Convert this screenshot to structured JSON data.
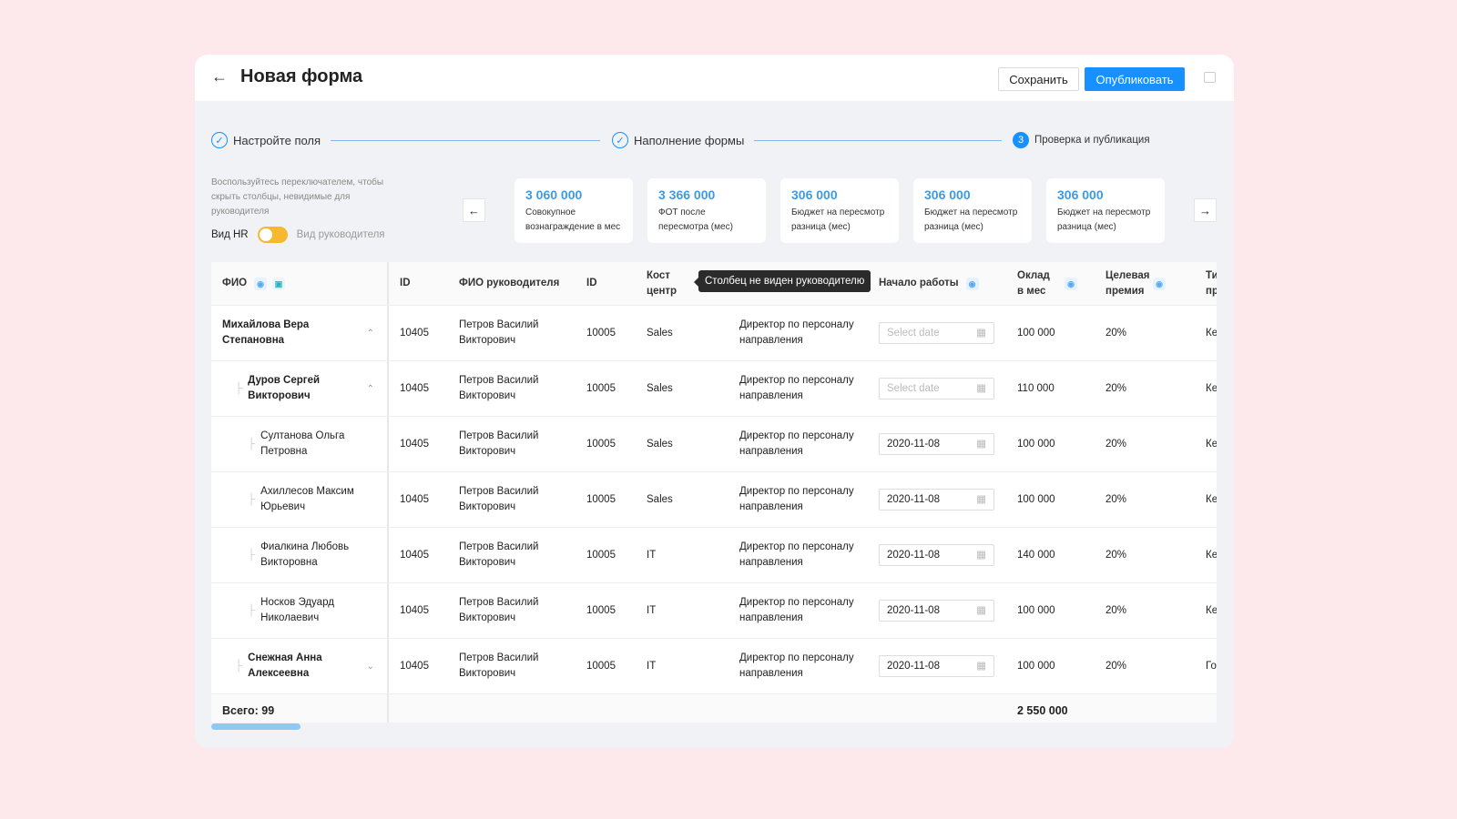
{
  "header": {
    "title": "Новая форма",
    "save_label": "Сохранить",
    "publish_label": "Опубликовать"
  },
  "steps": [
    {
      "label": "Настройте поля",
      "state": "done"
    },
    {
      "label": "Наполнение формы",
      "state": "done"
    },
    {
      "label": "Проверка и публикация",
      "state": "active",
      "number": "3"
    }
  ],
  "hint": "Воспользуйтесь переключателем, чтобы скрыть столбцы, невидимые для руководителя",
  "toggle": {
    "left": "Вид HR",
    "right": "Вид руководителя",
    "on": false
  },
  "kpis": [
    {
      "value": "3 060 000",
      "label": "Совокупное вознаграждение в мес"
    },
    {
      "value": "3 366 000",
      "label": "ФОТ после пересмотра (мес)"
    },
    {
      "value": "306 000",
      "label": "Бюджет на пересмотр разница (мес)"
    },
    {
      "value": "306 000",
      "label": "Бюджет на пересмотр разница (мес)"
    },
    {
      "value": "306 000",
      "label": "Бюджет на пересмотр разница (мес)"
    }
  ],
  "table": {
    "columns": [
      "ФИО",
      "ID",
      "ФИО руководителя",
      "ID",
      "Кост центр",
      "",
      "Начало работы",
      "Оклад в мес",
      "Целевая премия",
      "Ти пр"
    ],
    "tooltip": "Столбец не виден руководителю",
    "date_placeholder": "Select date",
    "rows": [
      {
        "name": "Михайлова Вера Степановна",
        "level": 0,
        "expand": "up",
        "id": "10405",
        "manager": "Петров Василий Викторович",
        "mid": "10005",
        "cc": "Sales",
        "pos": "Директор по персоналу направления",
        "date": "",
        "salary": "100 000",
        "bonus": "20%",
        "type": "Ке"
      },
      {
        "name": "Дуров Сергей Викторович",
        "level": 1,
        "expand": "up",
        "id": "10405",
        "manager": "Петров Василий Викторович",
        "mid": "10005",
        "cc": "Sales",
        "pos": "Директор по персоналу направления",
        "date": "",
        "salary": "110 000",
        "bonus": "20%",
        "type": "Ке"
      },
      {
        "name": "Султанова Ольга Петровна",
        "level": 2,
        "id": "10405",
        "manager": "Петров Василий Викторович",
        "mid": "10005",
        "cc": "Sales",
        "pos": "Директор по персоналу направления",
        "date": "2020-11-08",
        "salary": "100 000",
        "bonus": "20%",
        "type": "Ке"
      },
      {
        "name": "Ахиллесов Максим Юрьевич",
        "level": 2,
        "id": "10405",
        "manager": "Петров Василий Викторович",
        "mid": "10005",
        "cc": "Sales",
        "pos": "Директор по персоналу направления",
        "date": "2020-11-08",
        "salary": "100 000",
        "bonus": "20%",
        "type": "Ке"
      },
      {
        "name": "Фиалкина Любовь Викторовна",
        "level": 2,
        "id": "10405",
        "manager": "Петров Василий Викторович",
        "mid": "10005",
        "cc": "IT",
        "pos": "Директор по персоналу направления",
        "date": "2020-11-08",
        "salary": "140 000",
        "bonus": "20%",
        "type": "Ке"
      },
      {
        "name": "Носков Эдуард Николаевич",
        "level": 2,
        "id": "10405",
        "manager": "Петров Василий Викторович",
        "mid": "10005",
        "cc": "IT",
        "pos": "Директор по персоналу направления",
        "date": "2020-11-08",
        "salary": "100 000",
        "bonus": "20%",
        "type": "Ке"
      },
      {
        "name": "Снежная Анна Алексеевна",
        "level": 1,
        "expand": "down",
        "id": "10405",
        "manager": "Петров Василий Викторович",
        "mid": "10005",
        "cc": "IT",
        "pos": "Директор по персоналу направления",
        "date": "2020-11-08",
        "salary": "100 000",
        "bonus": "20%",
        "type": "Го"
      }
    ],
    "total_label": "Всего: 99",
    "total_salary": "2 550 000"
  }
}
